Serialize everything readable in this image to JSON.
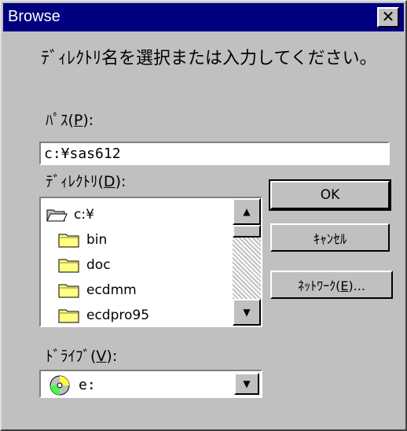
{
  "window": {
    "title": "Browse",
    "close_symbol": "✕"
  },
  "instruction": "ﾃﾞｨﾚｸﾄﾘ名を選択または入力してください。",
  "path": {
    "label": "ﾊﾟｽ(",
    "accel": "P",
    "label_end": "):",
    "value": "c:¥sas612"
  },
  "directory": {
    "label": "ﾃﾞｨﾚｸﾄﾘ(",
    "accel": "D",
    "label_end": "):",
    "items": [
      {
        "name": "c:¥",
        "icon": "open-folder-icon"
      },
      {
        "name": "bin",
        "icon": "folder-icon"
      },
      {
        "name": "doc",
        "icon": "folder-icon"
      },
      {
        "name": "ecdmm",
        "icon": "folder-icon"
      },
      {
        "name": "ecdpro95",
        "icon": "folder-icon"
      }
    ]
  },
  "drive": {
    "label": "ﾄﾞﾗｲﾌﾞ(",
    "accel": "V",
    "label_end": "):",
    "value": "e:",
    "icon": "cd-drive-icon"
  },
  "buttons": {
    "ok": "OK",
    "cancel": "ｷｬﾝｾﾙ",
    "network": "ﾈｯﾄﾜｰｸ(",
    "network_accel": "E",
    "network_end": ")..."
  },
  "colors": {
    "face": "#c0c0c0",
    "titlebar": "#000080",
    "folder": "#ffff80",
    "white": "#ffffff"
  }
}
